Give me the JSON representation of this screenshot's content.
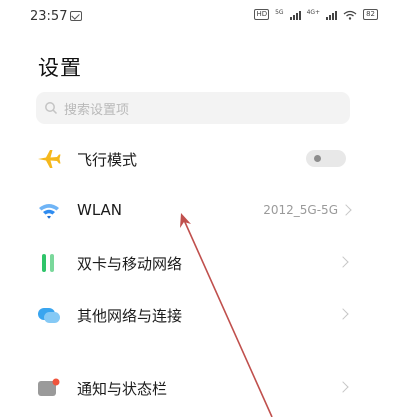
{
  "status_bar": {
    "time": "23:57",
    "hd_label": "HD",
    "net_label_1": "5G",
    "net_label_2": "4G+",
    "battery": "82"
  },
  "page": {
    "title": "设置"
  },
  "search": {
    "placeholder": "搜索设置项"
  },
  "items": [
    {
      "label": "飞行模式",
      "icon": "airplane-icon",
      "control": "toggle",
      "toggle_on": false
    },
    {
      "label": "WLAN",
      "icon": "wifi-icon",
      "value": "2012_5G-5G",
      "control": "chevron"
    },
    {
      "label": "双卡与移动网络",
      "icon": "dual-sim-icon",
      "control": "chevron"
    },
    {
      "label": "其他网络与连接",
      "icon": "cloud-icon",
      "control": "chevron"
    },
    {
      "label": "通知与状态栏",
      "icon": "notification-icon",
      "control": "chevron"
    }
  ],
  "colors": {
    "airplane": "#f5b81c",
    "wifi": "#2f8cf0",
    "dual_sim": "#2fc46a",
    "cloud": "#3aa5ef",
    "notification": "#8c8c8c",
    "annotation_arrow": "#c0504d"
  }
}
